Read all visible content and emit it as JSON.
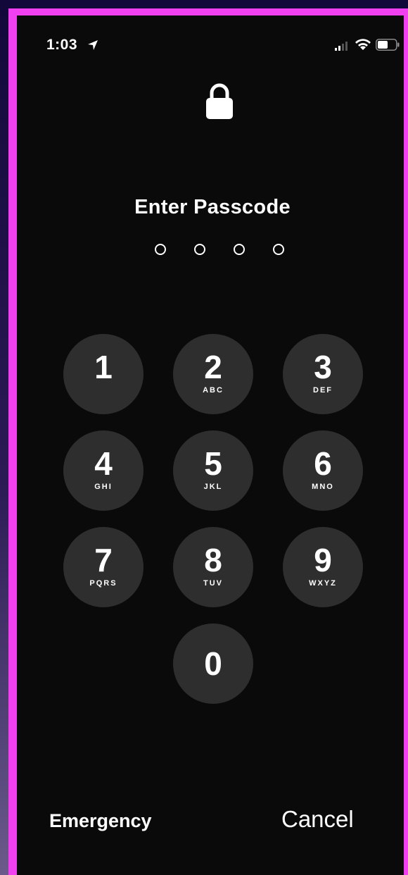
{
  "status_bar": {
    "time": "1:03"
  },
  "lock_screen": {
    "title": "Enter Passcode",
    "passcode_length": 4
  },
  "keypad": [
    {
      "digit": "1",
      "letters": ""
    },
    {
      "digit": "2",
      "letters": "ABC"
    },
    {
      "digit": "3",
      "letters": "DEF"
    },
    {
      "digit": "4",
      "letters": "GHI"
    },
    {
      "digit": "5",
      "letters": "JKL"
    },
    {
      "digit": "6",
      "letters": "MNO"
    },
    {
      "digit": "7",
      "letters": "PQRS"
    },
    {
      "digit": "8",
      "letters": "TUV"
    },
    {
      "digit": "9",
      "letters": "WXYZ"
    },
    {
      "digit": "0",
      "letters": ""
    }
  ],
  "actions": {
    "emergency_label": "Emergency",
    "cancel_label": "Cancel"
  },
  "icons": {
    "location": "location-arrow-icon",
    "signal": "cellular-signal-icon",
    "wifi": "wifi-icon",
    "battery": "battery-icon",
    "lock": "lock-icon"
  },
  "colors": {
    "frame_border": "#f040f0",
    "screen_background": "#0a0a0a",
    "key_background": "#2e2e2e",
    "text": "#ffffff"
  }
}
